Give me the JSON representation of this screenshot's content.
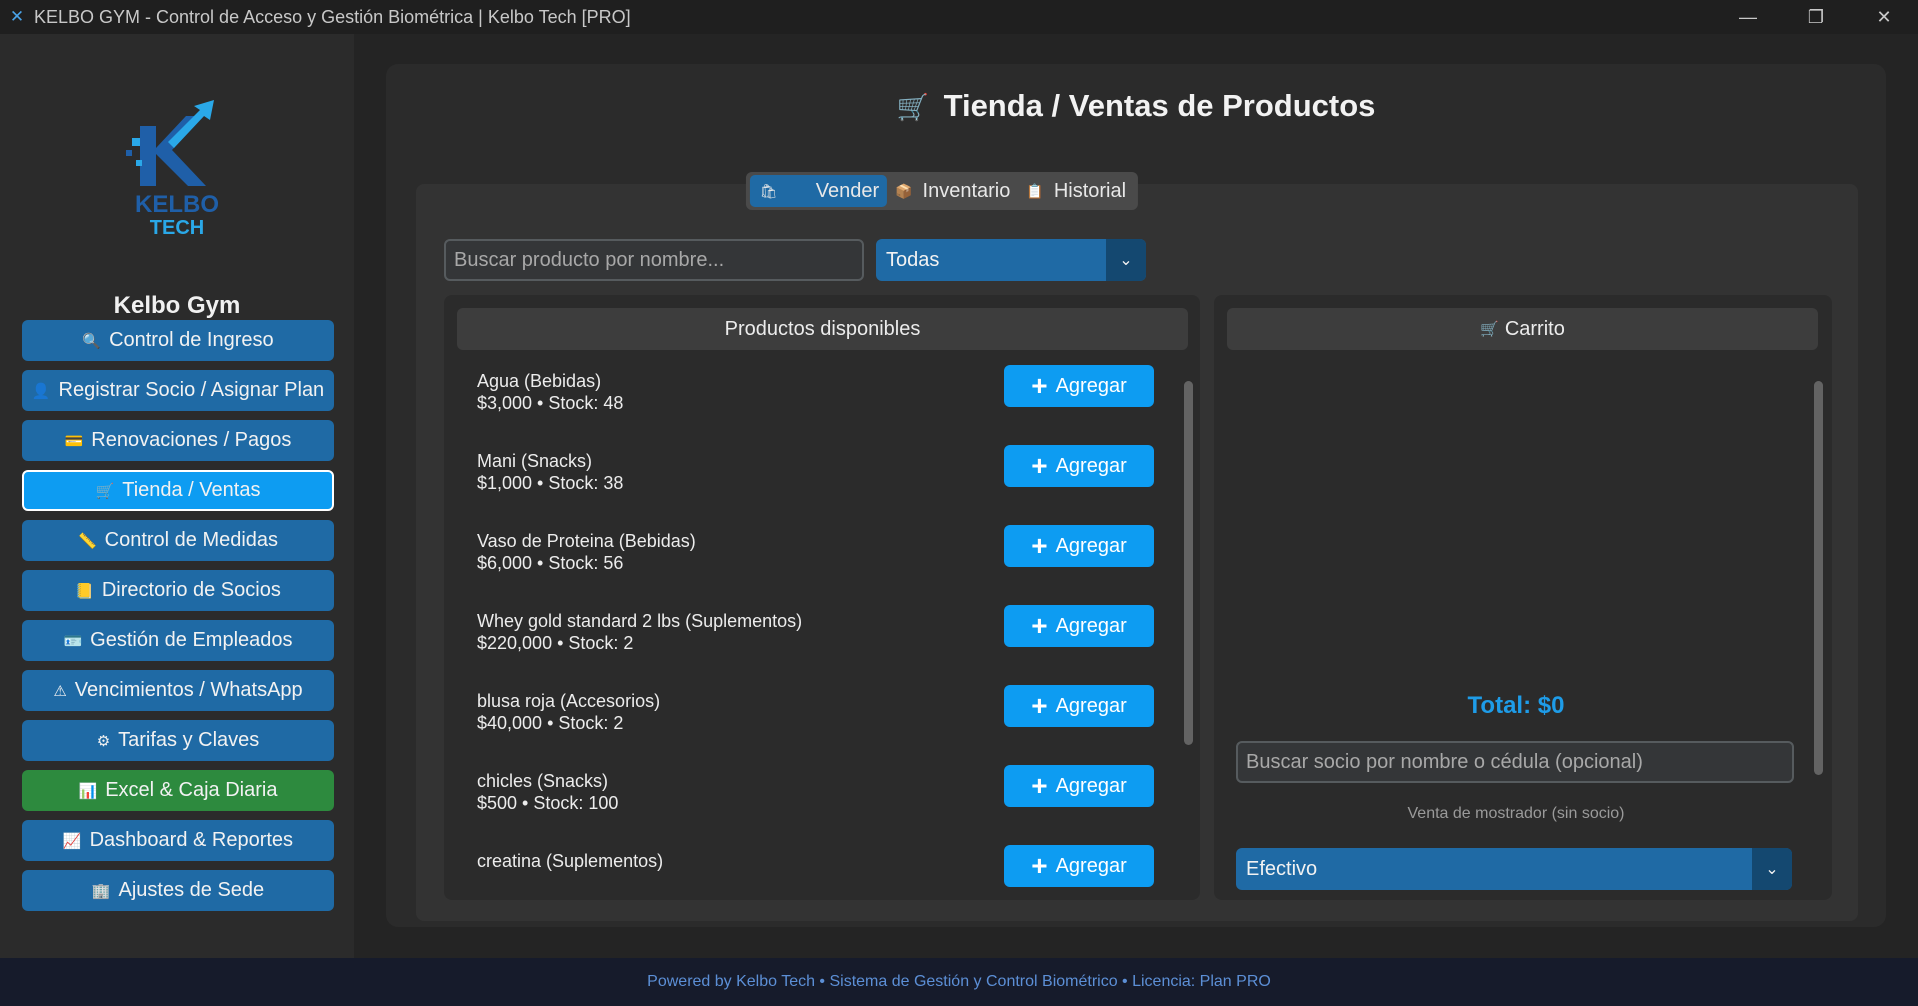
{
  "window": {
    "title": "KELBO GYM - Control de Acceso y Gestión Biométrica | Kelbo Tech [PRO]",
    "controls": {
      "minimize": "—",
      "maximize": "❐",
      "close": "✕"
    }
  },
  "sidebar": {
    "logo_text": [
      "KELBO",
      "TECH"
    ],
    "gym_name": "Kelbo Gym",
    "items": [
      {
        "label": "Control de Ingreso",
        "icon": "search-icon",
        "glyph": "🔍"
      },
      {
        "label": "Registrar Socio / Asignar Plan",
        "icon": "user-icon",
        "glyph": "👤"
      },
      {
        "label": "Renovaciones / Pagos",
        "icon": "card-icon",
        "glyph": "💳"
      },
      {
        "label": "Tienda / Ventas",
        "icon": "cart-icon",
        "glyph": "🛒"
      },
      {
        "label": "Control de Medidas",
        "icon": "ruler-icon",
        "glyph": "📏"
      },
      {
        "label": "Directorio de Socios",
        "icon": "notebook-icon",
        "glyph": "📒"
      },
      {
        "label": "Gestión de Empleados",
        "icon": "id-badge-icon",
        "glyph": "🪪"
      },
      {
        "label": "Vencimientos / WhatsApp",
        "icon": "warning-icon",
        "glyph": "⚠"
      },
      {
        "label": "Tarifas y Claves",
        "icon": "gear-icon",
        "glyph": "⚙"
      },
      {
        "label": "Excel & Caja Diaria",
        "icon": "bar-chart-icon",
        "glyph": "📊"
      },
      {
        "label": "Dashboard & Reportes",
        "icon": "line-chart-icon",
        "glyph": "📈"
      },
      {
        "label": "Ajustes de Sede",
        "icon": "building-icon",
        "glyph": "🏢"
      }
    ],
    "active_index": 3
  },
  "main": {
    "title": "Tienda / Ventas de Productos",
    "title_glyph": "🛒",
    "tabs": [
      {
        "label": "Vender",
        "glyph": "🛍"
      },
      {
        "label": "Inventario",
        "glyph": "📦"
      },
      {
        "label": "Historial",
        "glyph": "📋"
      }
    ],
    "active_tab": 0,
    "search": {
      "placeholder": "Buscar producto por nombre...",
      "value": ""
    },
    "category_select": {
      "value": "Todas",
      "arrow": "⌄"
    },
    "products_header": "Productos disponibles",
    "add_label": "Agregar",
    "add_glyph": "+",
    "products": [
      {
        "name": "Agua  (Bebidas)",
        "meta": "$3,000  •  Stock: 48"
      },
      {
        "name": "Mani  (Snacks)",
        "meta": "$1,000  •  Stock: 38"
      },
      {
        "name": "Vaso de Proteina  (Bebidas)",
        "meta": "$6,000  •  Stock: 56"
      },
      {
        "name": "Whey gold standard 2 lbs  (Suplementos)",
        "meta": "$220,000  •  Stock: 2"
      },
      {
        "name": "blusa roja  (Accesorios)",
        "meta": "$40,000  •  Stock: 2"
      },
      {
        "name": "chicles  (Snacks)",
        "meta": "$500  •  Stock: 100"
      },
      {
        "name": "creatina  (Suplementos)",
        "meta": ""
      }
    ],
    "cart": {
      "header": "Carrito",
      "header_glyph": "🛒",
      "total": "Total: $0",
      "member_search": {
        "placeholder": "Buscar socio por nombre o cédula (opcional)",
        "value": ""
      },
      "note": "Venta de mostrador (sin socio)",
      "payment_select": {
        "value": "Efectivo",
        "arrow": "⌄"
      }
    }
  },
  "footer": {
    "text": "Powered by Kelbo Tech  •  Sistema de Gestión y Control Biométrico  •  Licencia: Plan PRO"
  },
  "colors": {
    "accent": "#1f6aa5",
    "accent_bright": "#0d9cf2",
    "green": "#2d8a3e",
    "total": "#1e9ce8",
    "footer_text": "#5c8fd6"
  }
}
